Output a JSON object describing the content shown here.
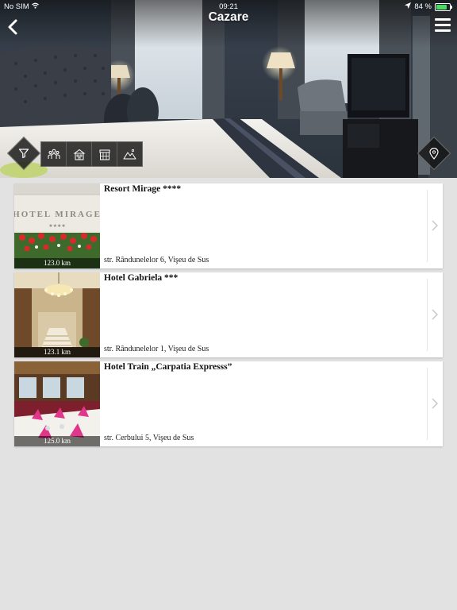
{
  "status_bar": {
    "carrier": "No SIM",
    "time": "09:21",
    "battery_percent": "84 %",
    "battery_level": 0.84
  },
  "header": {
    "title": "Cazare"
  },
  "hotels": [
    {
      "name": "Resort Mirage ****",
      "address": "str. Rândunelelor 6, Vişeu de Sus",
      "distance": "123.0 km",
      "sign_text": "HOTEL MIRAGE",
      "stars_text": "★★★★"
    },
    {
      "name": "Hotel Gabriela ***",
      "address": "str. Rândunelelor 1, Vişeu de Sus",
      "distance": "123.1 km"
    },
    {
      "name": "Hotel Train „Carpatia Expresss”",
      "address": "str. Cerbului 5, Vişeu de Sus",
      "distance": "125.0 km"
    }
  ],
  "colors": {
    "background": "#e2e2e2",
    "card": "#ffffff",
    "overlay": "#141414"
  },
  "icons": {
    "back": "chevron-left",
    "menu": "hamburger",
    "filter": "funnel",
    "map": "location-pin",
    "categories": [
      "crowd",
      "building",
      "storefront",
      "mountains"
    ]
  }
}
